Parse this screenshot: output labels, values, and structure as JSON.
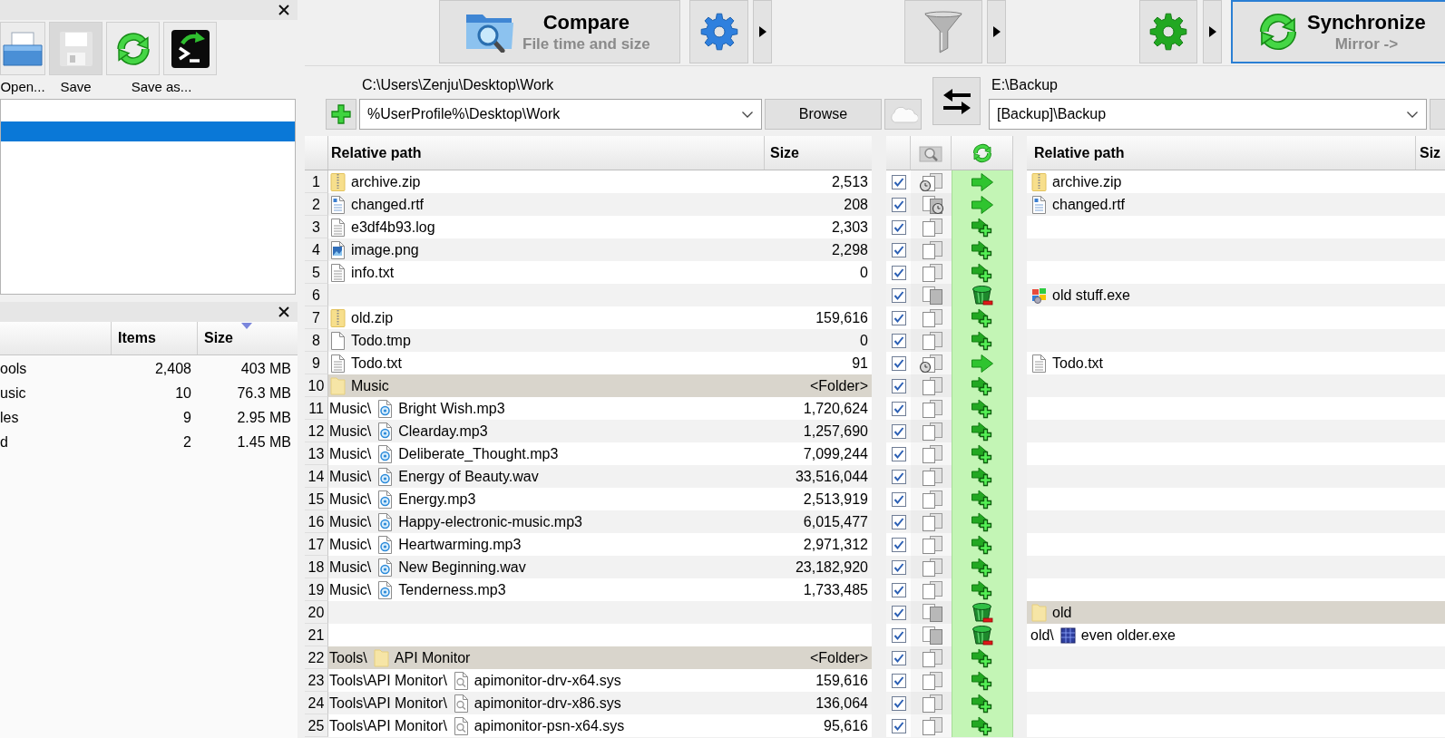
{
  "config_panel": {
    "buttons": [
      {
        "kind": "open",
        "disabled": false
      },
      {
        "kind": "save",
        "disabled": true
      },
      {
        "kind": "save-as",
        "disabled": false
      },
      {
        "kind": "batch",
        "disabled": false
      }
    ],
    "labels": [
      "Open...",
      "Save",
      "Save as..."
    ],
    "items": [
      {
        "selected": true
      }
    ]
  },
  "overview": {
    "columns": [
      {
        "label": "Items",
        "sorted": false
      },
      {
        "label": "Size",
        "sorted": true
      }
    ],
    "rows": [
      {
        "name": "ools",
        "items": "2,408",
        "size": "403 MB"
      },
      {
        "name": "usic",
        "items": "10",
        "size": "76.3 MB"
      },
      {
        "name": "les",
        "items": "9",
        "size": "2.95 MB"
      },
      {
        "name": "d",
        "items": "2",
        "size": "1.45 MB"
      }
    ]
  },
  "toolbar": {
    "compare": {
      "title": "Compare",
      "subtitle": "File time and size"
    },
    "synchronize": {
      "title": "Synchronize",
      "subtitle": "Mirror ->"
    }
  },
  "folder_pair": {
    "left": {
      "path": "C:\\Users\\Zenju\\Desktop\\Work",
      "value": "%UserProfile%\\Desktop\\Work",
      "browse": "Browse"
    },
    "right": {
      "path": "E:\\Backup",
      "value": "[Backup]\\Backup"
    }
  },
  "grid": {
    "left_columns": [
      "Relative path",
      "Size"
    ],
    "right_columns": [
      "Relative path",
      "Siz"
    ],
    "rows": [
      {
        "num": "1",
        "left": {
          "name": "archive.zip",
          "kind": "zip",
          "size": "2,513"
        },
        "checked": true,
        "category": {
          "kind": "left-newer"
        },
        "action": {
          "kind": "overwrite"
        },
        "right": {
          "name": "archive.zip",
          "kind": "zip"
        }
      },
      {
        "num": "2",
        "left": {
          "name": "changed.rtf",
          "kind": "rtf",
          "size": "208"
        },
        "checked": true,
        "category": {
          "kind": "right-newer"
        },
        "action": {
          "kind": "overwrite"
        },
        "right": {
          "name": "changed.rtf",
          "kind": "rtf"
        }
      },
      {
        "num": "3",
        "left": {
          "name": "e3df4b93.log",
          "kind": "text",
          "size": "2,303"
        },
        "checked": true,
        "category": {
          "kind": "left-only"
        },
        "action": {
          "kind": "create"
        }
      },
      {
        "num": "4",
        "left": {
          "name": "image.png",
          "kind": "image",
          "size": "2,298"
        },
        "checked": true,
        "category": {
          "kind": "left-only"
        },
        "action": {
          "kind": "create"
        }
      },
      {
        "num": "5",
        "left": {
          "name": "info.txt",
          "kind": "text",
          "size": "0"
        },
        "checked": true,
        "category": {
          "kind": "left-only"
        },
        "action": {
          "kind": "create"
        }
      },
      {
        "num": "6",
        "checked": true,
        "category": {
          "kind": "right-only"
        },
        "action": {
          "kind": "delete"
        },
        "right": {
          "name": "old stuff.exe",
          "kind": "program"
        }
      },
      {
        "num": "7",
        "left": {
          "name": "old.zip",
          "kind": "zip",
          "size": "159,616"
        },
        "checked": true,
        "category": {
          "kind": "left-only"
        },
        "action": {
          "kind": "create"
        }
      },
      {
        "num": "8",
        "left": {
          "name": "Todo.tmp",
          "kind": "blank",
          "size": "0"
        },
        "checked": true,
        "category": {
          "kind": "left-only"
        },
        "action": {
          "kind": "create"
        }
      },
      {
        "num": "9",
        "left": {
          "name": "Todo.txt",
          "kind": "text",
          "size": "91"
        },
        "checked": true,
        "category": {
          "kind": "left-newer"
        },
        "action": {
          "kind": "overwrite"
        },
        "right": {
          "name": "Todo.txt",
          "kind": "text"
        }
      },
      {
        "num": "10",
        "left": {
          "name": "Music",
          "kind": "folder",
          "size": "<Folder>"
        },
        "checked": true,
        "category": {
          "kind": "left-only"
        },
        "action": {
          "kind": "create"
        }
      },
      {
        "num": "11",
        "left": {
          "prefix": "Music\\",
          "name": "Bright Wish.mp3",
          "kind": "audio",
          "size": "1,720,624"
        },
        "checked": true,
        "category": {
          "kind": "left-only"
        },
        "action": {
          "kind": "create"
        }
      },
      {
        "num": "12",
        "left": {
          "prefix": "Music\\",
          "name": "Clearday.mp3",
          "kind": "audio",
          "size": "1,257,690"
        },
        "checked": true,
        "category": {
          "kind": "left-only"
        },
        "action": {
          "kind": "create"
        }
      },
      {
        "num": "13",
        "left": {
          "prefix": "Music\\",
          "name": "Deliberate_Thought.mp3",
          "kind": "audio",
          "size": "7,099,244"
        },
        "checked": true,
        "category": {
          "kind": "left-only"
        },
        "action": {
          "kind": "create"
        }
      },
      {
        "num": "14",
        "left": {
          "prefix": "Music\\",
          "name": "Energy of Beauty.wav",
          "kind": "audio",
          "size": "33,516,044"
        },
        "checked": true,
        "category": {
          "kind": "left-only"
        },
        "action": {
          "kind": "create"
        }
      },
      {
        "num": "15",
        "left": {
          "prefix": "Music\\",
          "name": "Energy.mp3",
          "kind": "audio",
          "size": "2,513,919"
        },
        "checked": true,
        "category": {
          "kind": "left-only"
        },
        "action": {
          "kind": "create"
        }
      },
      {
        "num": "16",
        "left": {
          "prefix": "Music\\",
          "name": "Happy-electronic-music.mp3",
          "kind": "audio",
          "size": "6,015,477"
        },
        "checked": true,
        "category": {
          "kind": "left-only"
        },
        "action": {
          "kind": "create"
        }
      },
      {
        "num": "17",
        "left": {
          "prefix": "Music\\",
          "name": "Heartwarming.mp3",
          "kind": "audio",
          "size": "2,971,312"
        },
        "checked": true,
        "category": {
          "kind": "left-only"
        },
        "action": {
          "kind": "create"
        }
      },
      {
        "num": "18",
        "left": {
          "prefix": "Music\\",
          "name": "New Beginning.wav",
          "kind": "audio",
          "size": "23,182,920"
        },
        "checked": true,
        "category": {
          "kind": "left-only"
        },
        "action": {
          "kind": "create"
        }
      },
      {
        "num": "19",
        "left": {
          "prefix": "Music\\",
          "name": "Tenderness.mp3",
          "kind": "audio",
          "size": "1,733,485"
        },
        "checked": true,
        "category": {
          "kind": "left-only"
        },
        "action": {
          "kind": "create"
        }
      },
      {
        "num": "20",
        "checked": true,
        "category": {
          "kind": "right-only"
        },
        "action": {
          "kind": "delete"
        },
        "right": {
          "name": "old",
          "kind": "folder"
        }
      },
      {
        "num": "21",
        "checked": true,
        "category": {
          "kind": "right-only"
        },
        "action": {
          "kind": "delete"
        },
        "right": {
          "prefix": "old\\",
          "name": "even older.exe",
          "kind": "app"
        }
      },
      {
        "num": "22",
        "left": {
          "prefix": "Tools\\",
          "name": "API Monitor",
          "kind": "folder",
          "size": "<Folder>"
        },
        "checked": true,
        "category": {
          "kind": "left-only"
        },
        "action": {
          "kind": "create"
        }
      },
      {
        "num": "23",
        "left": {
          "prefix": "Tools\\API Monitor\\",
          "name": "apimonitor-drv-x64.sys",
          "kind": "sys",
          "size": "159,616"
        },
        "checked": true,
        "category": {
          "kind": "left-only"
        },
        "action": {
          "kind": "create"
        }
      },
      {
        "num": "24",
        "left": {
          "prefix": "Tools\\API Monitor\\",
          "name": "apimonitor-drv-x86.sys",
          "kind": "sys",
          "size": "136,064"
        },
        "checked": true,
        "category": {
          "kind": "left-only"
        },
        "action": {
          "kind": "create"
        }
      },
      {
        "num": "25",
        "left": {
          "prefix": "Tools\\API Monitor\\",
          "name": "apimonitor-psn-x64.sys",
          "kind": "sys",
          "size": "95,616"
        },
        "checked": true,
        "category": {
          "kind": "left-only"
        },
        "action": {
          "kind": "create"
        }
      }
    ]
  }
}
